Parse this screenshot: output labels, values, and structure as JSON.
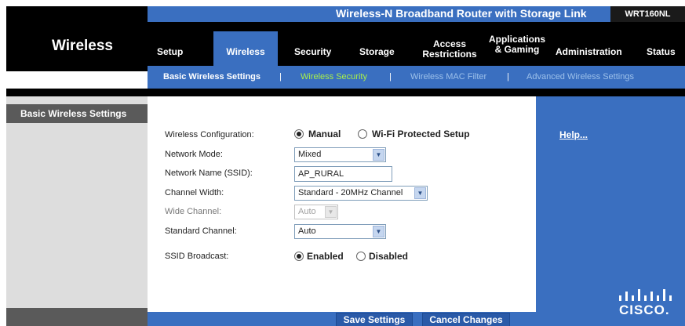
{
  "header": {
    "product_title": "Wireless-N Broadband Router with Storage Link",
    "model": "WRT160NL",
    "section_title": "Wireless"
  },
  "tabs": [
    {
      "label": "Setup"
    },
    {
      "label": "Wireless",
      "active": true
    },
    {
      "label": "Security"
    },
    {
      "label": "Storage"
    },
    {
      "label": "Access Restrictions"
    },
    {
      "label": "Applications & Gaming"
    },
    {
      "label": "Administration"
    },
    {
      "label": "Status"
    }
  ],
  "subnav": {
    "items": [
      {
        "label": "Basic Wireless Settings"
      },
      {
        "label": "Wireless Security"
      },
      {
        "label": "Wireless MAC Filter"
      },
      {
        "label": "Advanced Wireless Settings"
      }
    ],
    "separator": "|"
  },
  "sidebar": {
    "heading": "Basic Wireless Settings"
  },
  "form": {
    "wireless_configuration": {
      "label": "Wireless Configuration:",
      "options": [
        "Manual",
        "Wi-Fi Protected Setup"
      ],
      "selected": "Manual"
    },
    "network_mode": {
      "label": "Network Mode:",
      "value": "Mixed"
    },
    "ssid": {
      "label": "Network Name (SSID):",
      "value": "AP_RURAL"
    },
    "channel_width": {
      "label": "Channel Width:",
      "value": "Standard - 20MHz Channel"
    },
    "wide_channel": {
      "label": "Wide Channel:",
      "value": "Auto",
      "disabled": true
    },
    "standard_channel": {
      "label": "Standard Channel:",
      "value": "Auto"
    },
    "ssid_broadcast": {
      "label": "SSID Broadcast:",
      "options": [
        "Enabled",
        "Disabled"
      ],
      "selected": "Enabled"
    }
  },
  "help": {
    "link": "Help..."
  },
  "brand": {
    "logo_text": "CISCO."
  },
  "actions": {
    "save": "Save Settings",
    "cancel": "Cancel Changes"
  },
  "colors": {
    "accent_blue": "#3a6fc0",
    "active_subnav": "#a8ef4a",
    "black_bar": "#000000",
    "sidebar_gray": "#dddddd"
  }
}
